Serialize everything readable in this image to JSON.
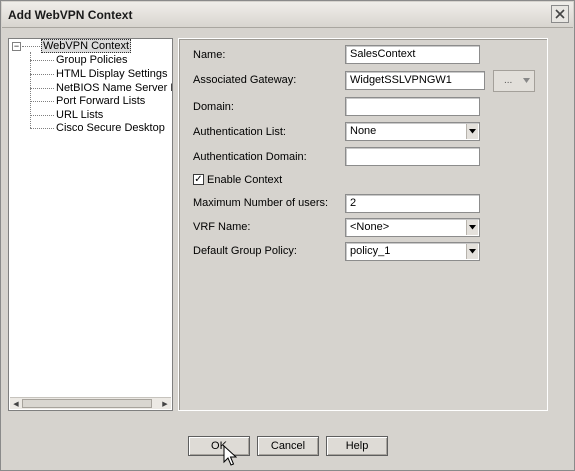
{
  "window": {
    "title": "Add WebVPN Context"
  },
  "tree": {
    "root": "WebVPN Context",
    "children": [
      "Group Policies",
      "HTML Display Settings",
      "NetBIOS Name Server Lis",
      "Port Forward Lists",
      "URL Lists",
      "Cisco Secure Desktop"
    ]
  },
  "form": {
    "name_label": "Name:",
    "name_value": "SalesContext",
    "gateway_label": "Associated Gateway:",
    "gateway_value": "WidgetSSLVPNGW1",
    "gateway_browse": "...",
    "domain_label": "Domain:",
    "domain_value": "",
    "auth_list_label": "Authentication List:",
    "auth_list_value": "None",
    "auth_domain_label": "Authentication Domain:",
    "auth_domain_value": "",
    "enable_context_label": "Enable Context",
    "enable_context_checked": true,
    "max_users_label": "Maximum Number of users:",
    "max_users_value": "2",
    "vrf_label": "VRF Name:",
    "vrf_value": "<None>",
    "group_policy_label": "Default Group Policy:",
    "group_policy_value": "policy_1"
  },
  "buttons": {
    "ok": "OK",
    "cancel": "Cancel",
    "help": "Help"
  }
}
